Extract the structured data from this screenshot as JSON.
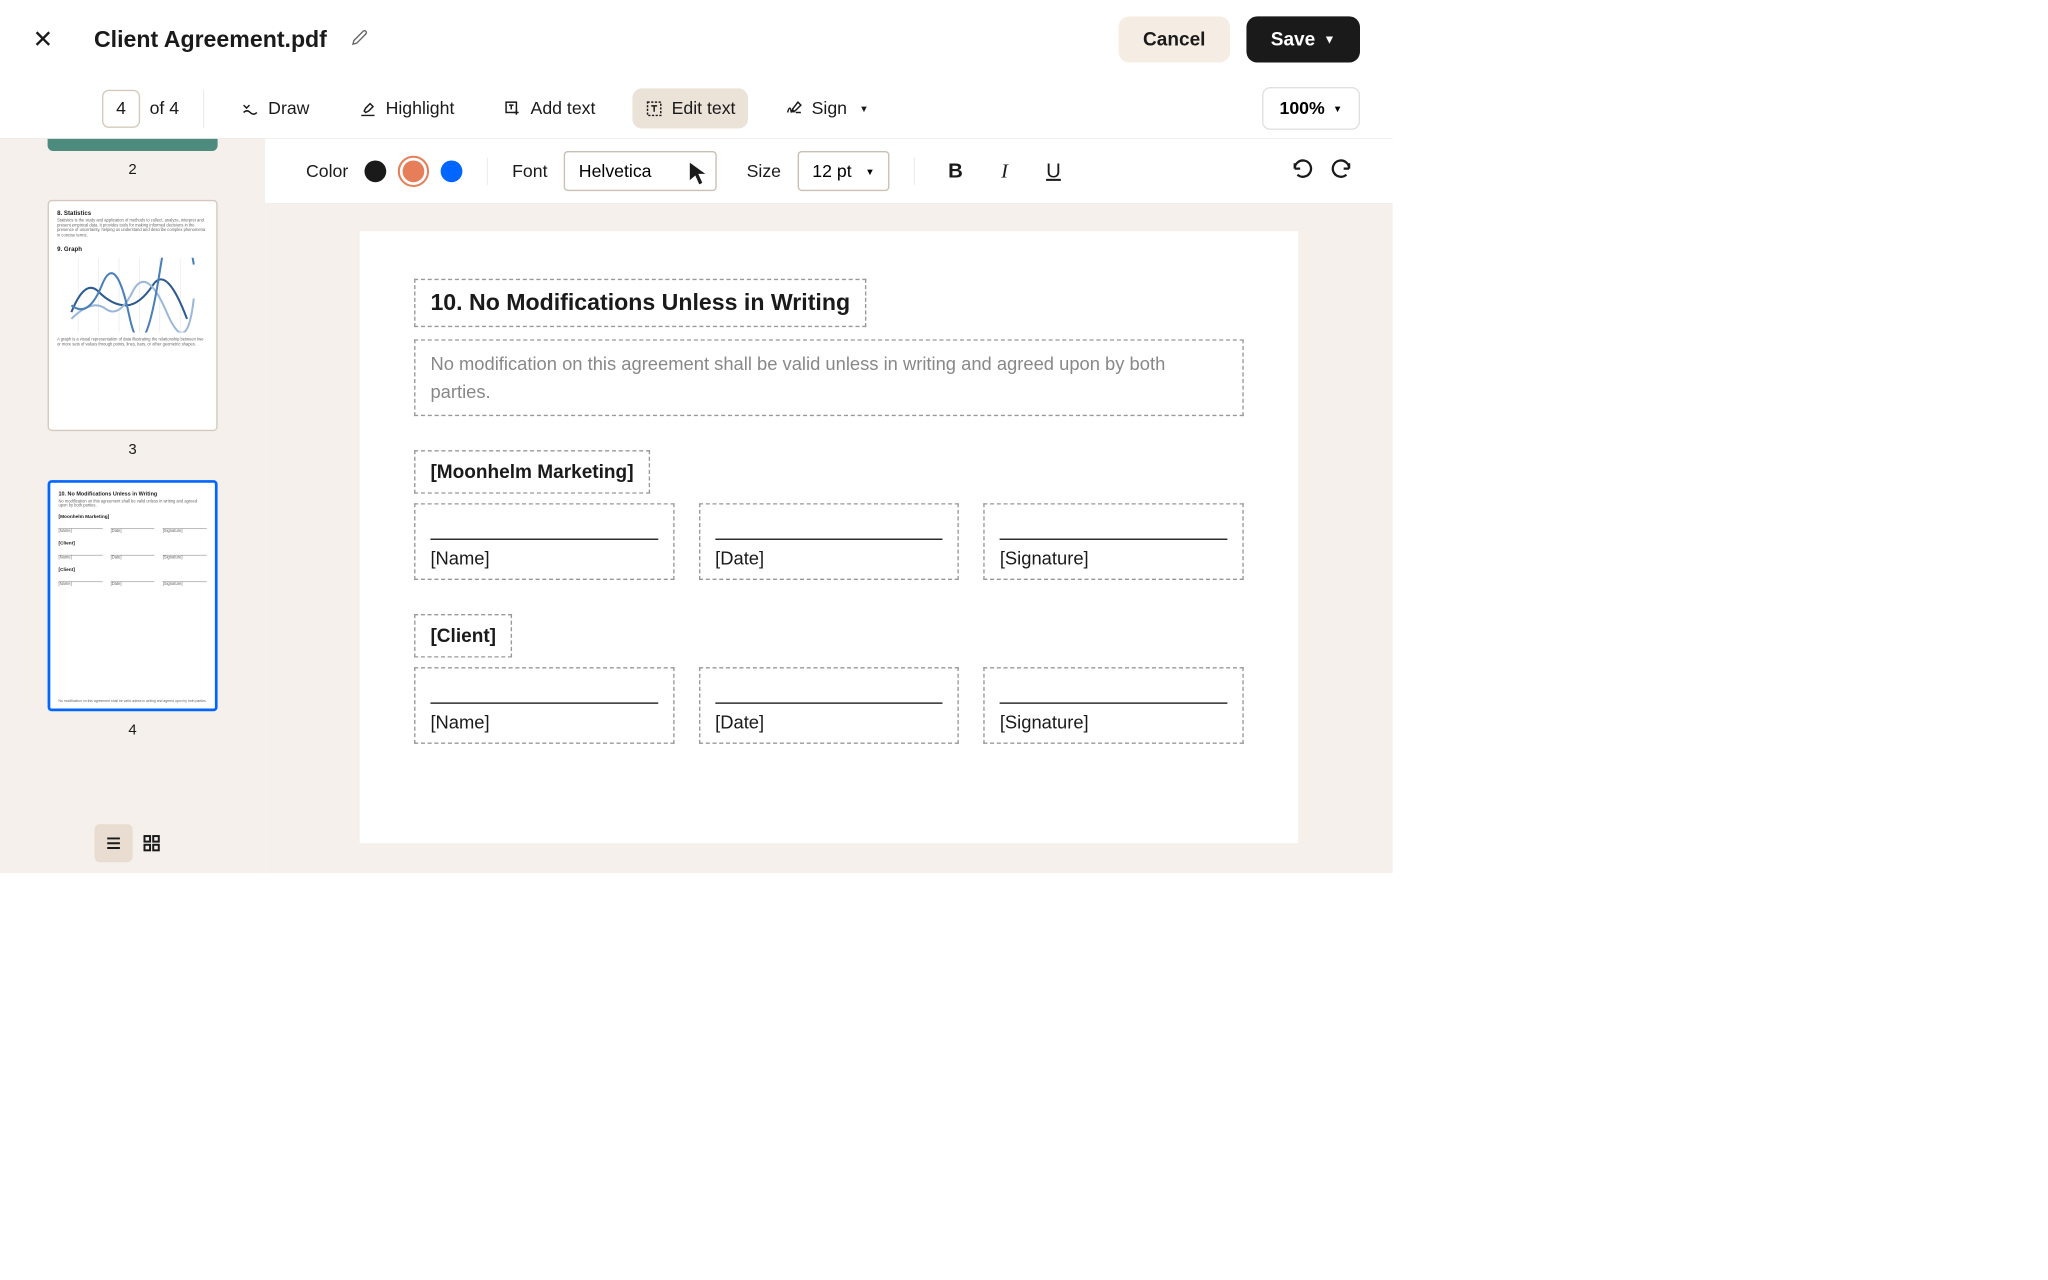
{
  "header": {
    "title": "Client Agreement.pdf",
    "cancel": "Cancel",
    "save": "Save"
  },
  "toolbar": {
    "current_page": "4",
    "page_total": "of 4",
    "draw": "Draw",
    "highlight": "Highlight",
    "add_text": "Add text",
    "edit_text": "Edit text",
    "sign": "Sign",
    "zoom": "100%"
  },
  "format": {
    "color_label": "Color",
    "font_label": "Font",
    "font_value": "Helvetica",
    "size_label": "Size",
    "size_value": "12 pt"
  },
  "thumbnails": {
    "p2": "2",
    "p3": "3",
    "p4": "4",
    "p3_title1": "8. Statistics",
    "p3_body1": "Statistics is the study and application of methods to collect, analyze, interpret and present empirical data. It provides tools for making informed decisions in the presence of uncertainty, helping us understand and describe complex phenomena in concise terms.",
    "p3_title2": "9. Graph",
    "p3_body2": "A graph is a visual representation of data illustrating the relationship between two or more sets of values through points, lines, bars, or other geometric shapes.",
    "p4_title": "10. No Modifications Unless in Writing",
    "p4_body": "No modification on this agreement shall be valid unless in writing and agreed upon by both parties.",
    "p4_party1": "[Moonhelm Marketing]",
    "p4_party2": "[Client]",
    "p4_name": "[Name]",
    "p4_date": "[Date]",
    "p4_sig": "[Signature]",
    "p4_footer": "No modification on this agreement shall be valid unless in writing and agreed upon by both parties."
  },
  "document": {
    "heading": "10. No Modifications Unless in Writing",
    "body": "No modification on this agreement shall be valid unless in writing and agreed upon by both parties.",
    "party1": "[Moonhelm Marketing]",
    "party2": "[Client]",
    "name": "[Name]",
    "date": "[Date]",
    "signature": "[Signature]"
  }
}
